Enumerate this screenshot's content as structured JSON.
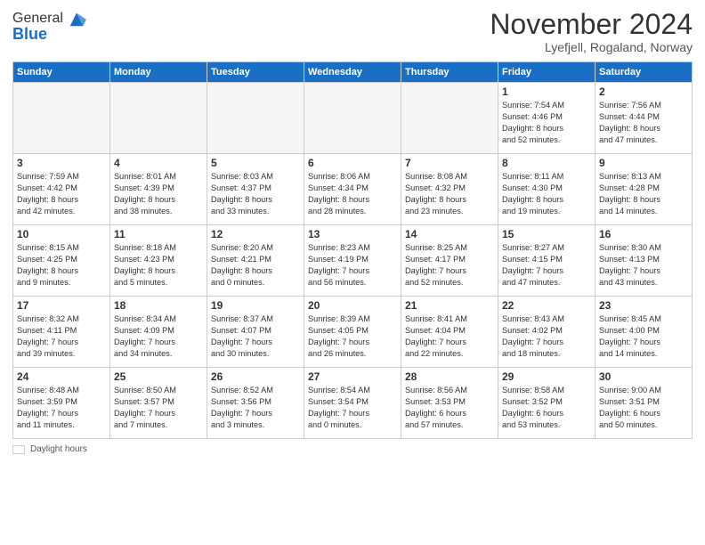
{
  "header": {
    "logo_line1": "General",
    "logo_line2": "Blue",
    "month_title": "November 2024",
    "location": "Lyefjell, Rogaland, Norway"
  },
  "days_of_week": [
    "Sunday",
    "Monday",
    "Tuesday",
    "Wednesday",
    "Thursday",
    "Friday",
    "Saturday"
  ],
  "footer": {
    "label": "Daylight hours"
  },
  "weeks": [
    [
      {
        "day": "",
        "info": ""
      },
      {
        "day": "",
        "info": ""
      },
      {
        "day": "",
        "info": ""
      },
      {
        "day": "",
        "info": ""
      },
      {
        "day": "",
        "info": ""
      },
      {
        "day": "1",
        "info": "Sunrise: 7:54 AM\nSunset: 4:46 PM\nDaylight: 8 hours\nand 52 minutes."
      },
      {
        "day": "2",
        "info": "Sunrise: 7:56 AM\nSunset: 4:44 PM\nDaylight: 8 hours\nand 47 minutes."
      }
    ],
    [
      {
        "day": "3",
        "info": "Sunrise: 7:59 AM\nSunset: 4:42 PM\nDaylight: 8 hours\nand 42 minutes."
      },
      {
        "day": "4",
        "info": "Sunrise: 8:01 AM\nSunset: 4:39 PM\nDaylight: 8 hours\nand 38 minutes."
      },
      {
        "day": "5",
        "info": "Sunrise: 8:03 AM\nSunset: 4:37 PM\nDaylight: 8 hours\nand 33 minutes."
      },
      {
        "day": "6",
        "info": "Sunrise: 8:06 AM\nSunset: 4:34 PM\nDaylight: 8 hours\nand 28 minutes."
      },
      {
        "day": "7",
        "info": "Sunrise: 8:08 AM\nSunset: 4:32 PM\nDaylight: 8 hours\nand 23 minutes."
      },
      {
        "day": "8",
        "info": "Sunrise: 8:11 AM\nSunset: 4:30 PM\nDaylight: 8 hours\nand 19 minutes."
      },
      {
        "day": "9",
        "info": "Sunrise: 8:13 AM\nSunset: 4:28 PM\nDaylight: 8 hours\nand 14 minutes."
      }
    ],
    [
      {
        "day": "10",
        "info": "Sunrise: 8:15 AM\nSunset: 4:25 PM\nDaylight: 8 hours\nand 9 minutes."
      },
      {
        "day": "11",
        "info": "Sunrise: 8:18 AM\nSunset: 4:23 PM\nDaylight: 8 hours\nand 5 minutes."
      },
      {
        "day": "12",
        "info": "Sunrise: 8:20 AM\nSunset: 4:21 PM\nDaylight: 8 hours\nand 0 minutes."
      },
      {
        "day": "13",
        "info": "Sunrise: 8:23 AM\nSunset: 4:19 PM\nDaylight: 7 hours\nand 56 minutes."
      },
      {
        "day": "14",
        "info": "Sunrise: 8:25 AM\nSunset: 4:17 PM\nDaylight: 7 hours\nand 52 minutes."
      },
      {
        "day": "15",
        "info": "Sunrise: 8:27 AM\nSunset: 4:15 PM\nDaylight: 7 hours\nand 47 minutes."
      },
      {
        "day": "16",
        "info": "Sunrise: 8:30 AM\nSunset: 4:13 PM\nDaylight: 7 hours\nand 43 minutes."
      }
    ],
    [
      {
        "day": "17",
        "info": "Sunrise: 8:32 AM\nSunset: 4:11 PM\nDaylight: 7 hours\nand 39 minutes."
      },
      {
        "day": "18",
        "info": "Sunrise: 8:34 AM\nSunset: 4:09 PM\nDaylight: 7 hours\nand 34 minutes."
      },
      {
        "day": "19",
        "info": "Sunrise: 8:37 AM\nSunset: 4:07 PM\nDaylight: 7 hours\nand 30 minutes."
      },
      {
        "day": "20",
        "info": "Sunrise: 8:39 AM\nSunset: 4:05 PM\nDaylight: 7 hours\nand 26 minutes."
      },
      {
        "day": "21",
        "info": "Sunrise: 8:41 AM\nSunset: 4:04 PM\nDaylight: 7 hours\nand 22 minutes."
      },
      {
        "day": "22",
        "info": "Sunrise: 8:43 AM\nSunset: 4:02 PM\nDaylight: 7 hours\nand 18 minutes."
      },
      {
        "day": "23",
        "info": "Sunrise: 8:45 AM\nSunset: 4:00 PM\nDaylight: 7 hours\nand 14 minutes."
      }
    ],
    [
      {
        "day": "24",
        "info": "Sunrise: 8:48 AM\nSunset: 3:59 PM\nDaylight: 7 hours\nand 11 minutes."
      },
      {
        "day": "25",
        "info": "Sunrise: 8:50 AM\nSunset: 3:57 PM\nDaylight: 7 hours\nand 7 minutes."
      },
      {
        "day": "26",
        "info": "Sunrise: 8:52 AM\nSunset: 3:56 PM\nDaylight: 7 hours\nand 3 minutes."
      },
      {
        "day": "27",
        "info": "Sunrise: 8:54 AM\nSunset: 3:54 PM\nDaylight: 7 hours\nand 0 minutes."
      },
      {
        "day": "28",
        "info": "Sunrise: 8:56 AM\nSunset: 3:53 PM\nDaylight: 6 hours\nand 57 minutes."
      },
      {
        "day": "29",
        "info": "Sunrise: 8:58 AM\nSunset: 3:52 PM\nDaylight: 6 hours\nand 53 minutes."
      },
      {
        "day": "30",
        "info": "Sunrise: 9:00 AM\nSunset: 3:51 PM\nDaylight: 6 hours\nand 50 minutes."
      }
    ]
  ]
}
